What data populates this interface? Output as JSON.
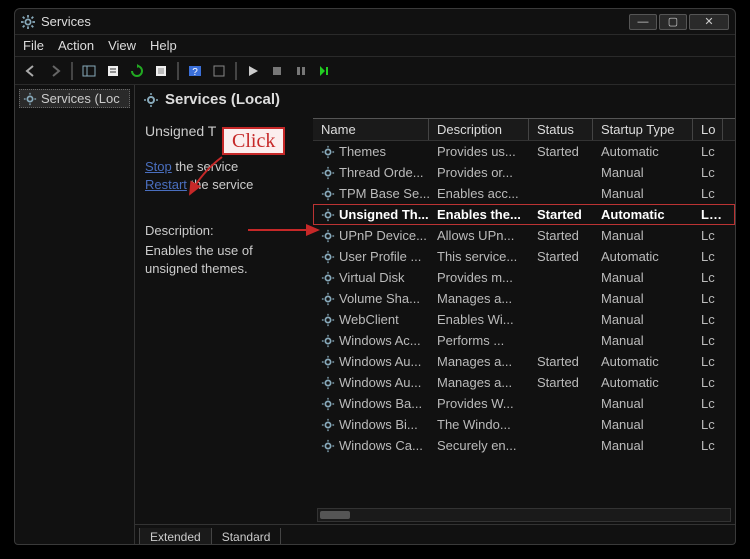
{
  "window": {
    "title": "Services"
  },
  "menu": {
    "file": "File",
    "action": "Action",
    "view": "View",
    "help": "Help"
  },
  "tree": {
    "root": "Services (Loc"
  },
  "header": {
    "title": "Services (Local)"
  },
  "selection": {
    "name": "Unsigned T",
    "stop_link": "Stop",
    "stop_suffix": " the service",
    "restart_link": "Restart",
    "restart_suffix": " the service",
    "desc_label": "Description:",
    "desc_text": "Enables the use of unsigned themes."
  },
  "columns": {
    "name": "Name",
    "description": "Description",
    "status": "Status",
    "startup": "Startup Type",
    "logon": "Lo"
  },
  "rows": [
    {
      "name": "Themes",
      "desc": "Provides us...",
      "status": "Started",
      "startup": "Automatic",
      "logon": "Lc"
    },
    {
      "name": "Thread Orde...",
      "desc": "Provides or...",
      "status": "",
      "startup": "Manual",
      "logon": "Lc"
    },
    {
      "name": "TPM Base Se...",
      "desc": "Enables acc...",
      "status": "",
      "startup": "Manual",
      "logon": "Lc"
    },
    {
      "name": "Unsigned Th...",
      "desc": "Enables the...",
      "status": "Started",
      "startup": "Automatic",
      "logon": "Lc",
      "selected": true
    },
    {
      "name": "UPnP Device...",
      "desc": "Allows UPn...",
      "status": "Started",
      "startup": "Manual",
      "logon": "Lc"
    },
    {
      "name": "User Profile ...",
      "desc": "This service...",
      "status": "Started",
      "startup": "Automatic",
      "logon": "Lc"
    },
    {
      "name": "Virtual Disk",
      "desc": "Provides m...",
      "status": "",
      "startup": "Manual",
      "logon": "Lc"
    },
    {
      "name": "Volume Sha...",
      "desc": "Manages a...",
      "status": "",
      "startup": "Manual",
      "logon": "Lc"
    },
    {
      "name": "WebClient",
      "desc": "Enables Wi...",
      "status": "",
      "startup": "Manual",
      "logon": "Lc"
    },
    {
      "name": "Windows Ac...",
      "desc": "Performs ...",
      "status": "",
      "startup": "Manual",
      "logon": "Lc"
    },
    {
      "name": "Windows Au...",
      "desc": "Manages a...",
      "status": "Started",
      "startup": "Automatic",
      "logon": "Lc"
    },
    {
      "name": "Windows Au...",
      "desc": "Manages a...",
      "status": "Started",
      "startup": "Automatic",
      "logon": "Lc"
    },
    {
      "name": "Windows Ba...",
      "desc": "Provides W...",
      "status": "",
      "startup": "Manual",
      "logon": "Lc"
    },
    {
      "name": "Windows Bi...",
      "desc": "The Windo...",
      "status": "",
      "startup": "Manual",
      "logon": "Lc"
    },
    {
      "name": "Windows Ca...",
      "desc": "Securely en...",
      "status": "",
      "startup": "Manual",
      "logon": "Lc"
    }
  ],
  "tabs": {
    "extended": "Extended",
    "standard": "Standard"
  },
  "annot": {
    "click": "Click"
  }
}
